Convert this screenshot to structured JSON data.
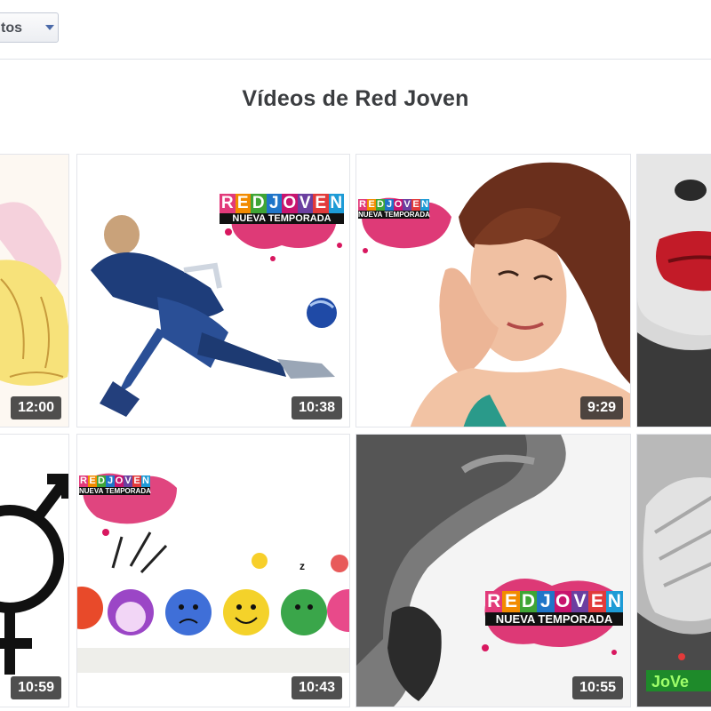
{
  "filter": {
    "label": "tos"
  },
  "page": {
    "title": "Vídeos de Red Joven"
  },
  "logo": {
    "letters": [
      "R",
      "E",
      "D",
      "J",
      "O",
      "V",
      "E",
      "N"
    ],
    "letter_colors": [
      "#e23a7a",
      "#f28b00",
      "#3fa535",
      "#1f75c8",
      "#c8146e",
      "#6b3fa0",
      "#e23a3a",
      "#1d9bd6"
    ],
    "subtitle": "NUEVA TEMPORADA",
    "splat_color": "#d8175f"
  },
  "watermark_green": "JoVe",
  "videos": [
    {
      "duration": "12:00"
    },
    {
      "duration": "10:38"
    },
    {
      "duration": "9:29"
    },
    {
      "duration": ""
    },
    {
      "duration": "10:59"
    },
    {
      "duration": "10:43"
    },
    {
      "duration": "10:55"
    },
    {
      "duration": ""
    }
  ]
}
